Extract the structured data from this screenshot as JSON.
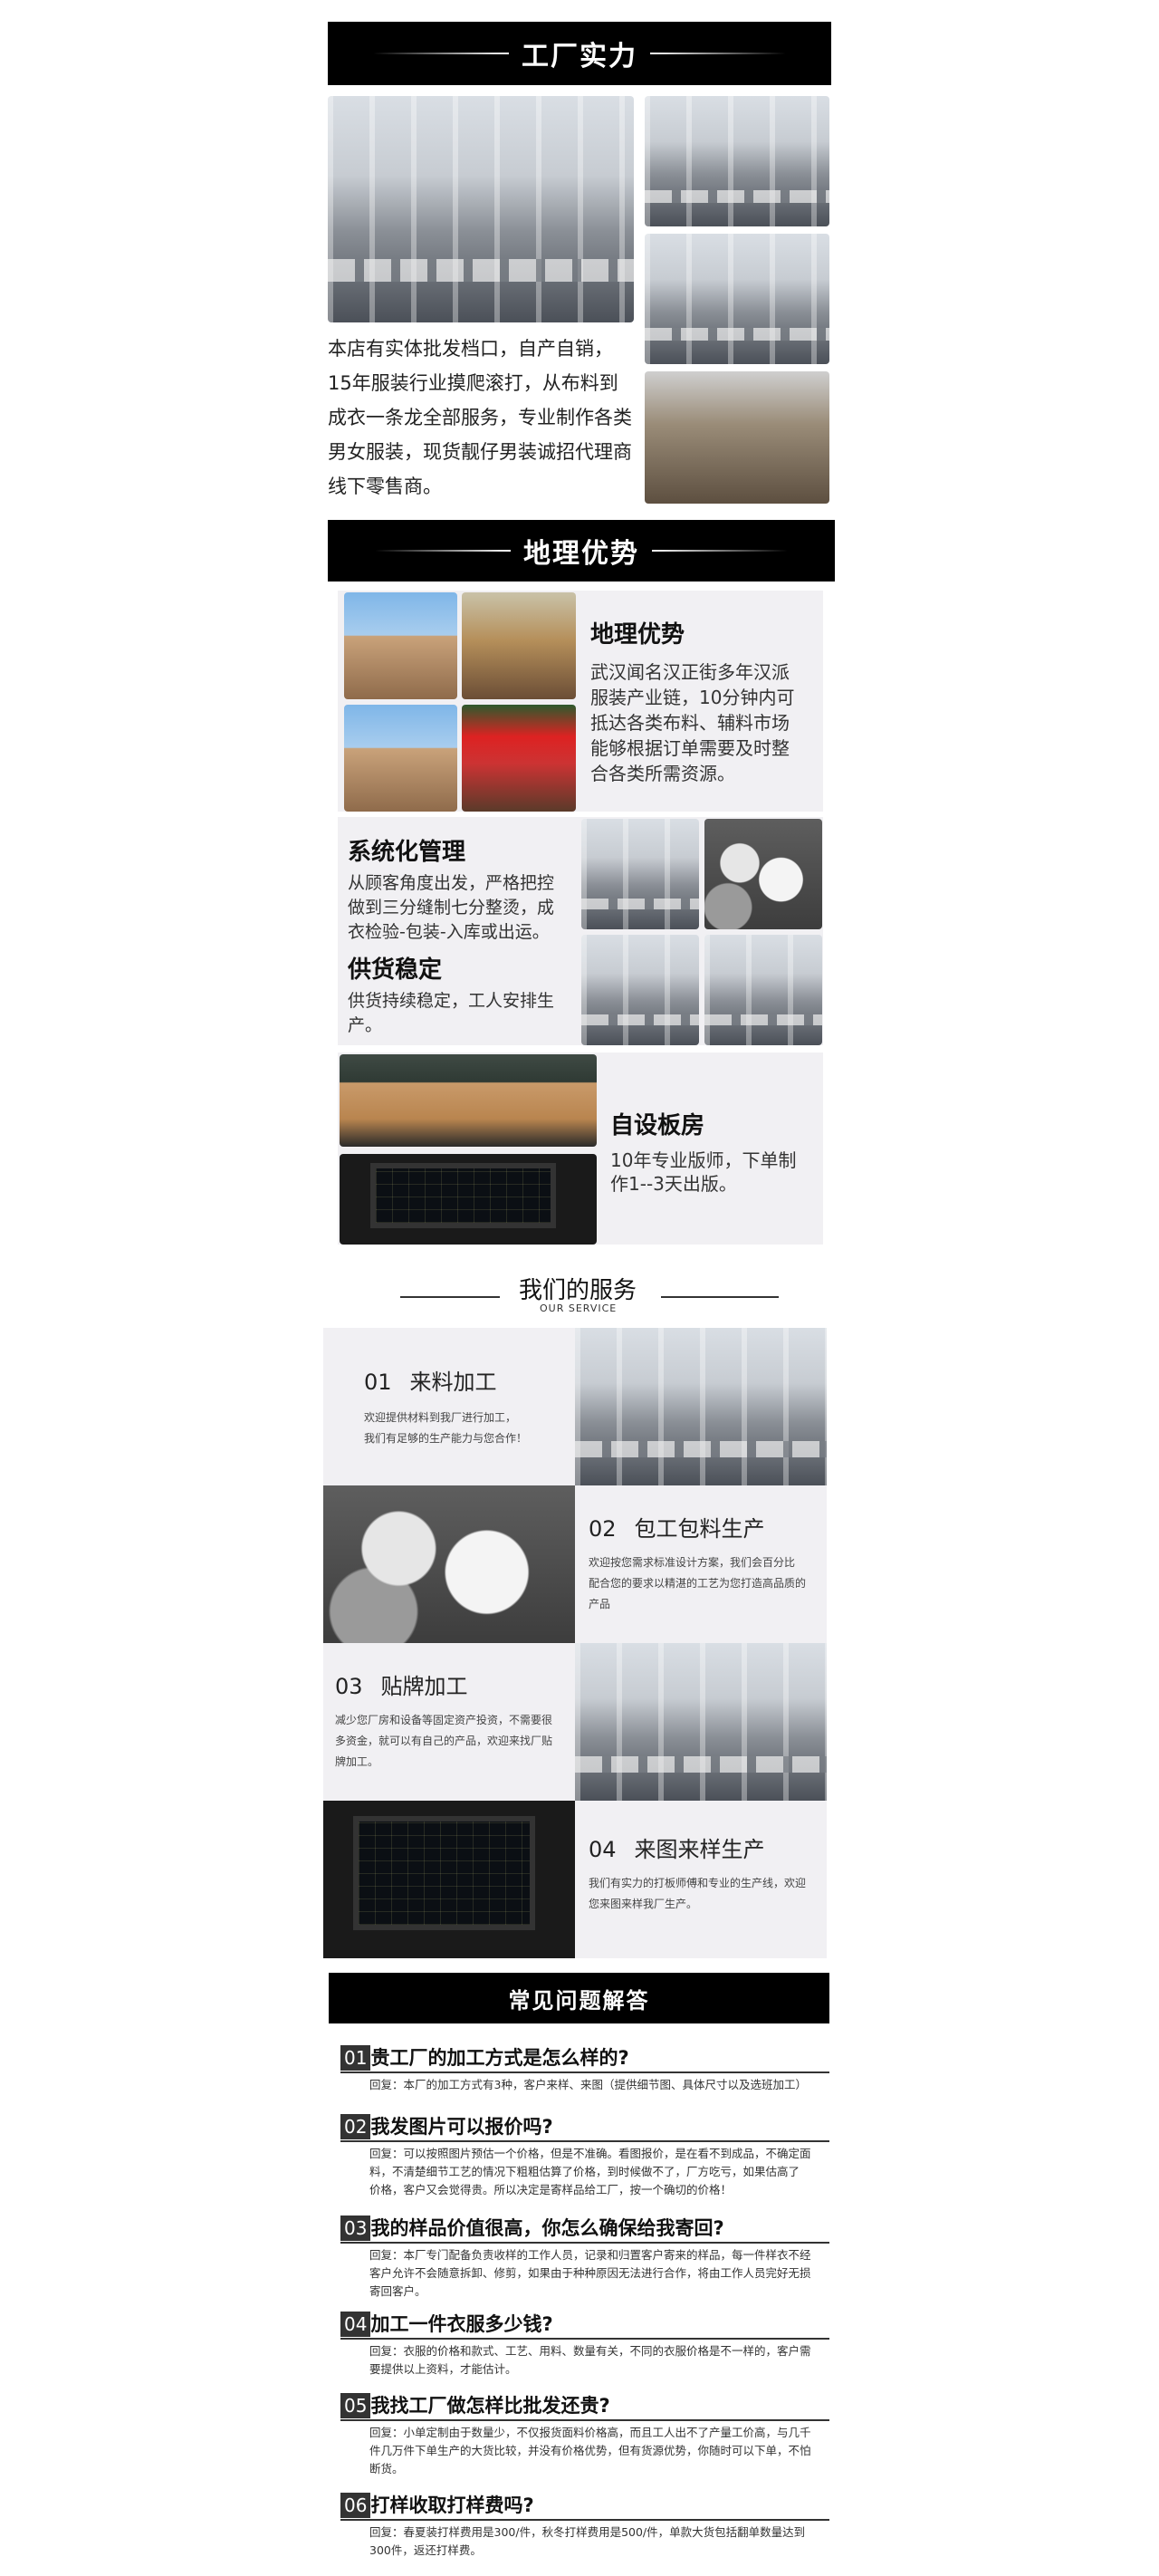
{
  "section1": {
    "title": "工厂实力",
    "paragraph_lines": [
      "本店有实体批发档口，自产自销，",
      "15年服装行业摸爬滚打，从布料到",
      "成衣一条龙全部服务，专业制作各类",
      "男女服装，现货靓仔男装诚招代理商",
      "线下零售商。"
    ]
  },
  "section2": {
    "title": "地理优势",
    "geo": {
      "heading": "地理优势",
      "lines": [
        "武汉闻名汉正街多年汉派",
        "服装产业链，10分钟内可",
        "抵达各类布料、辅料市场",
        "能够根据订单需要及时整",
        "合各类所需资源。"
      ]
    },
    "mgmt": {
      "heading": "系统化管理",
      "lines": [
        "从顾客角度出发，严格把控",
        "做到三分缝制七分整烫，成",
        "衣检验-包装-入库或出运。"
      ]
    },
    "supply": {
      "heading": "供货稳定",
      "lines": [
        "供货持续稳定，工人安排生",
        "产。"
      ]
    },
    "pattern": {
      "heading": "自设板房",
      "lines": [
        "10年专业版师，下单制",
        "作1--3天出版。"
      ]
    }
  },
  "services": {
    "title": "我们的服务",
    "subtitle": "OUR SERVICE",
    "items": [
      {
        "num": "01",
        "name": "来料加工",
        "lines": [
          "欢迎提供材料到我厂进行加工，",
          "我们有足够的生产能力与您合作！"
        ]
      },
      {
        "num": "02",
        "name": "包工包料生产",
        "lines": [
          "欢迎按您需求标准设计方案，我们会百分比",
          "配合您的要求以精湛的工艺为您打造高品质的",
          "产品"
        ]
      },
      {
        "num": "03",
        "name": "贴牌加工",
        "lines": [
          "减少您厂房和设备等固定资产投资，不需要很",
          "多资金，就可以有自己的产品，欢迎来找厂贴",
          "牌加工。"
        ]
      },
      {
        "num": "04",
        "name": "来图来样生产",
        "lines": [
          "我们有实力的打板师傅和专业的生产线，欢迎",
          "您来图来样我厂生产。"
        ]
      }
    ]
  },
  "faq": {
    "title": "常见问题解答",
    "items": [
      {
        "num": "01",
        "q": "贵工厂的加工方式是怎么样的?",
        "lines": [
          "回复：本厂的加工方式有3种，客户来样、来图（提供细节图、具体尺寸以及选班加工）"
        ]
      },
      {
        "num": "02",
        "q": "我发图片可以报价吗?",
        "lines": [
          "回复：可以按照图片预估一个价格，但是不准确。看图报价，是在看不到成品，不确定面",
          "料，不清楚细节工艺的情况下粗粗估算了价格，到时候做不了，厂方吃亏，如果估高了",
          "价格，客户又会觉得贵。所以决定是寄样品给工厂，按一个确切的价格！"
        ]
      },
      {
        "num": "03",
        "q": "我的样品价值很高，你怎么确保给我寄回?",
        "lines": [
          "回复：本厂专门配备负责收样的工作人员，记录和归置客户寄来的样品，每一件样衣不经",
          "客户允许不会随意拆卸、修剪，如果由于种种原因无法进行合作，将由工作人员完好无损",
          "寄回客户。"
        ]
      },
      {
        "num": "04",
        "q": "加工一件衣服多少钱?",
        "lines": [
          "回复：衣服的价格和款式、工艺、用料、数量有关，不同的衣服价格是不一样的，客户需",
          "要提供以上资料，才能估计。"
        ]
      },
      {
        "num": "05",
        "q": "我找工厂做怎样比批发还贵?",
        "lines": [
          "回复：小单定制由于数量少，不仅报货面料价格高，而且工人出不了产量工价高，与几千",
          "件几万件下单生产的大货比较，并没有价格优势，但有货源优势，你随时可以下单，不怕",
          "断货。"
        ]
      },
      {
        "num": "06",
        "q": "打样收取打样费吗?",
        "lines": [
          "回复：春夏装打样费用是300/件，秋冬打样费用是500/件，单款大货包括翻单数量达到",
          "300件，返还打样费。"
        ]
      }
    ]
  }
}
